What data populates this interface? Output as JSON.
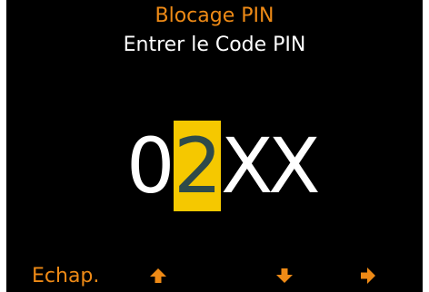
{
  "header": {
    "title": "Blocage PIN",
    "subtitle": "Entrer le Code PIN"
  },
  "pin": {
    "digits": [
      "0",
      "2",
      "X",
      "X"
    ],
    "active_index": 1
  },
  "softkeys": {
    "escape_label": "Echap.",
    "up_icon": "arrow-up-icon",
    "down_icon": "arrow-down-icon",
    "right_icon": "arrow-right-icon"
  },
  "colors": {
    "background": "#000000",
    "accent": "#ee8a16",
    "text": "#ffffff",
    "highlight": "#f5c800",
    "highlight_text": "#2e4a4a"
  }
}
